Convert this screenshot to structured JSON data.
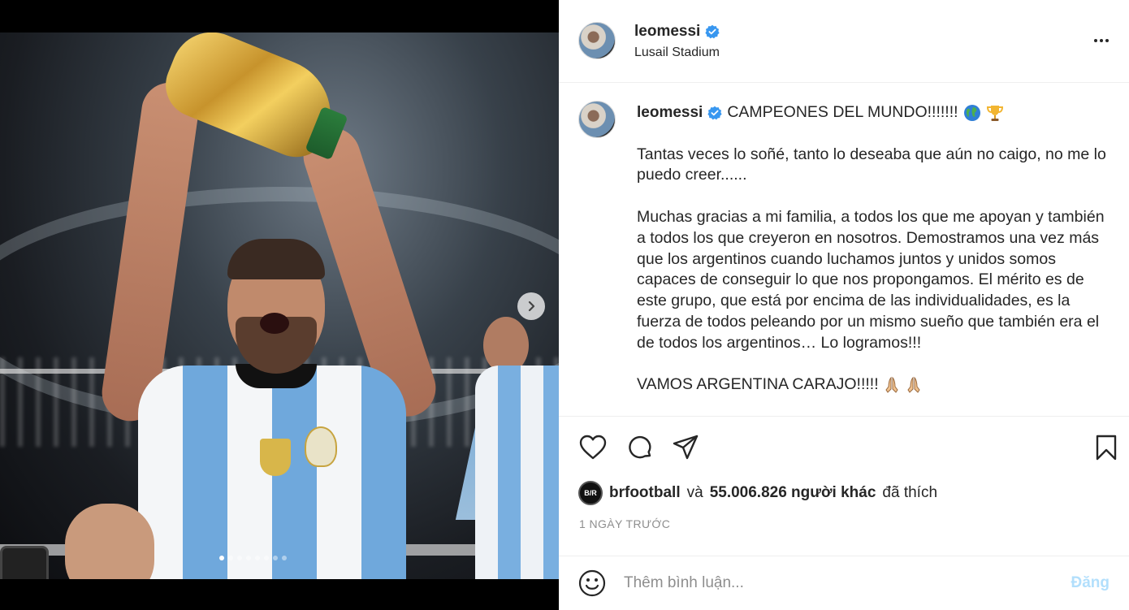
{
  "post": {
    "username": "leomessi",
    "location": "Lusail Stadium",
    "verified": true,
    "icons": {
      "verified": "verified-badge-icon",
      "more": "more-options-icon",
      "next": "chevron-right-icon",
      "like": "heart-icon",
      "comment": "comment-icon",
      "share": "share-icon",
      "save": "bookmark-icon",
      "emoji": "smile-icon"
    },
    "caption": {
      "title": "CAMPEONES DEL MUNDO!!!!!!!",
      "title_emojis": [
        "globe-emoji",
        "trophy-emoji"
      ],
      "paragraphs": [
        "Tantas veces lo soñé, tanto lo deseaba que aún no caigo, no me lo puedo creer......",
        "Muchas gracias a mi familia, a todos los que me apoyan y también a todos los que creyeron en nosotros. Demostramos una vez más que los argentinos cuando luchamos juntos y unidos somos capaces de conseguir lo que nos propongamos. El mérito es de este grupo, que está por encima de las individualidades, es la fuerza de todos peleando por un mismo sueño que también era el de todos los argentinos… Lo logramos!!!"
      ],
      "closing": "VAMOS ARGENTINA CARAJO!!!!!",
      "closing_emojis": [
        "praying-hands-emoji",
        "praying-hands-emoji"
      ]
    },
    "likes": {
      "liker_username": "brfootball",
      "liker_avatar_text": "B/R",
      "connector": "và",
      "count_text": "55.006.826 người khác",
      "suffix": "đã thích"
    },
    "time_ago": "1 NGÀY TRƯỚC",
    "comment": {
      "placeholder": "Thêm bình luận...",
      "value": "",
      "post_label": "Đăng"
    },
    "carousel": {
      "slide_count": 8,
      "active_index": 0
    },
    "colors": {
      "verified_blue": "#3897f0",
      "post_button_disabled": "#b2dffc",
      "secondary_text": "#8e8e8e"
    }
  }
}
